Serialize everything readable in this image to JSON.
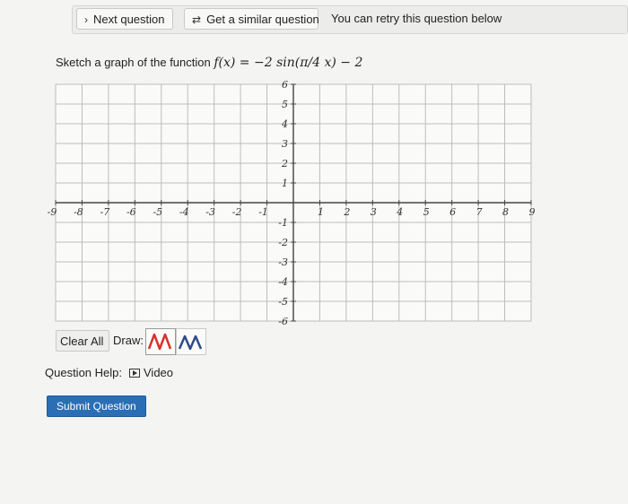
{
  "toolbar": {
    "next_label": "Next question",
    "similar_label": "Get a similar question",
    "retry_text": "You can retry this question below"
  },
  "question": {
    "prompt_prefix": "Sketch a graph of the function",
    "function_text": "f(x) = −2 sin(π/4 x) − 2"
  },
  "graph": {
    "x_min": -9,
    "x_max": 9,
    "y_min": -6,
    "y_max": 6,
    "grid": true,
    "x_tick_labels": [
      "-9",
      "-8",
      "-7",
      "-6",
      "-5",
      "-4",
      "-3",
      "-2",
      "-1",
      "1",
      "2",
      "3",
      "4",
      "5",
      "6",
      "7",
      "8",
      "9"
    ],
    "y_tick_labels": [
      "6",
      "5",
      "4",
      "3",
      "2",
      "1",
      "-1",
      "-2",
      "-3",
      "-4",
      "-5",
      "-6"
    ],
    "x_tick_values": [
      -9,
      -8,
      -7,
      -6,
      -5,
      -4,
      -3,
      -2,
      -1,
      1,
      2,
      3,
      4,
      5,
      6,
      7,
      8,
      9
    ],
    "y_tick_values": [
      6,
      5,
      4,
      3,
      2,
      1,
      -1,
      -2,
      -3,
      -4,
      -5,
      -6
    ],
    "grid_color": "#bdbdbd",
    "axis_color": "#444444"
  },
  "controls": {
    "clear_label": "Clear All",
    "draw_label": "Draw:",
    "tools": [
      {
        "name": "sine-tool-1",
        "color": "#d9302c"
      },
      {
        "name": "sine-tool-2",
        "color": "#2f4a8a"
      }
    ]
  },
  "help": {
    "label": "Question Help:",
    "video_label": "Video"
  },
  "submit": {
    "label": "Submit Question",
    "color": "#2a6fb5"
  }
}
